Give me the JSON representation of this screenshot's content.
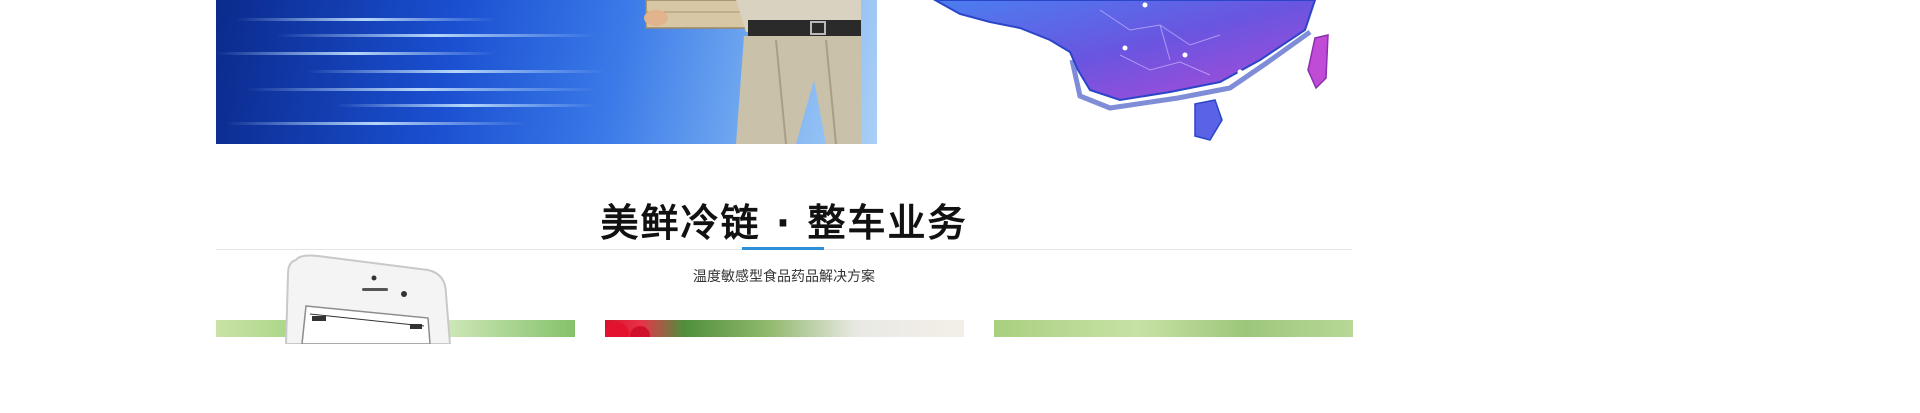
{
  "section": {
    "title": "美鲜冷链 · 整车业务",
    "subtitle": "温度敏感型食品药品解决方案"
  },
  "images": {
    "hero_left": "delivery-courier-with-boxes-on-blue-speed-background",
    "hero_right": "3d-china-map-purple-blue",
    "card_1": "green-produce-photo",
    "card_2": "strawberries-and-greens-photo",
    "card_3": "fresh-greens-photo",
    "phone": "smartphone-mockup"
  },
  "colors": {
    "accent": "#2c8fd8",
    "title": "#111111",
    "subtitle": "#333333",
    "divider": "#e3e3e3"
  }
}
